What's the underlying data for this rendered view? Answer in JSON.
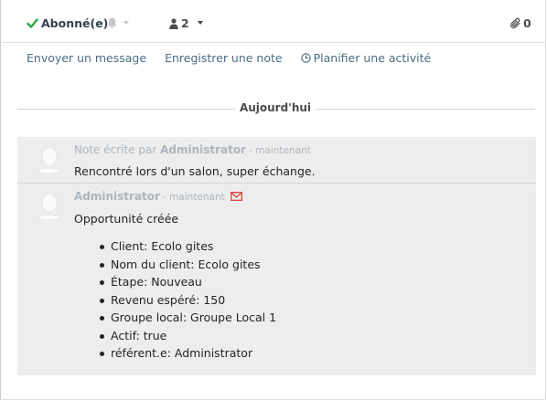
{
  "header": {
    "follow_label": "Abonné(e)",
    "followers_count": "2",
    "attachments_count": "0",
    "colors": {
      "follow_check": "#28a745",
      "muted_icon": "#c6c6c6"
    }
  },
  "actions": {
    "send_message": "Envoyer un message",
    "log_note": "Enregistrer une note",
    "schedule_activity": "Planifier une activité"
  },
  "separator": {
    "label": "Aujourd'hui"
  },
  "messages": [
    {
      "prefix": "Note écrite par",
      "author": "Administrator",
      "when": "- maintenant",
      "body": "Rencontré lors d'un salon, super échange."
    },
    {
      "author": "Administrator",
      "when": "- maintenant",
      "body": "Opportunité créée",
      "tracking": [
        "Client: Ecolo gites",
        "Nom du client: Ecolo gites",
        "Étape: Nouveau",
        "Revenu espéré: 150",
        "Groupe local: Groupe Local 1",
        "Actif: true",
        "référent.e: Administrator"
      ]
    }
  ],
  "icons": {
    "check": "check-icon",
    "bell": "bell-icon",
    "user": "user-icon",
    "paperclip": "paperclip-icon",
    "clock": "clock-icon",
    "envelope": "envelope-icon",
    "avatar": "avatar-icon"
  }
}
